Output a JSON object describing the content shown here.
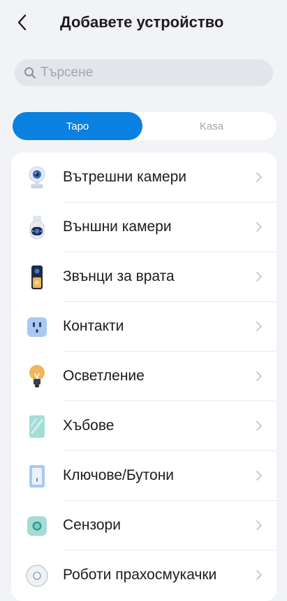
{
  "header": {
    "title": "Добавете устройство"
  },
  "search": {
    "placeholder": "Търсене"
  },
  "tabs": [
    {
      "label": "Tapo",
      "active": true
    },
    {
      "label": "Kasa",
      "active": false
    }
  ],
  "colors": {
    "accent": "#0a80e0",
    "background": "#f2f3f7",
    "card": "#ffffff"
  },
  "categories": [
    {
      "label": "Вътрешни камери",
      "icon": "indoor-camera-icon"
    },
    {
      "label": "Външни камери",
      "icon": "outdoor-camera-icon"
    },
    {
      "label": "Звънци за врата",
      "icon": "doorbell-icon"
    },
    {
      "label": "Контакти",
      "icon": "smart-plug-icon"
    },
    {
      "label": "Осветление",
      "icon": "light-bulb-icon"
    },
    {
      "label": "Хъбове",
      "icon": "hub-icon"
    },
    {
      "label": "Ключове/Бутони",
      "icon": "switch-icon"
    },
    {
      "label": "Сензори",
      "icon": "sensor-icon"
    },
    {
      "label": "Роботи прахосмукачки",
      "icon": "robot-vacuum-icon"
    }
  ]
}
